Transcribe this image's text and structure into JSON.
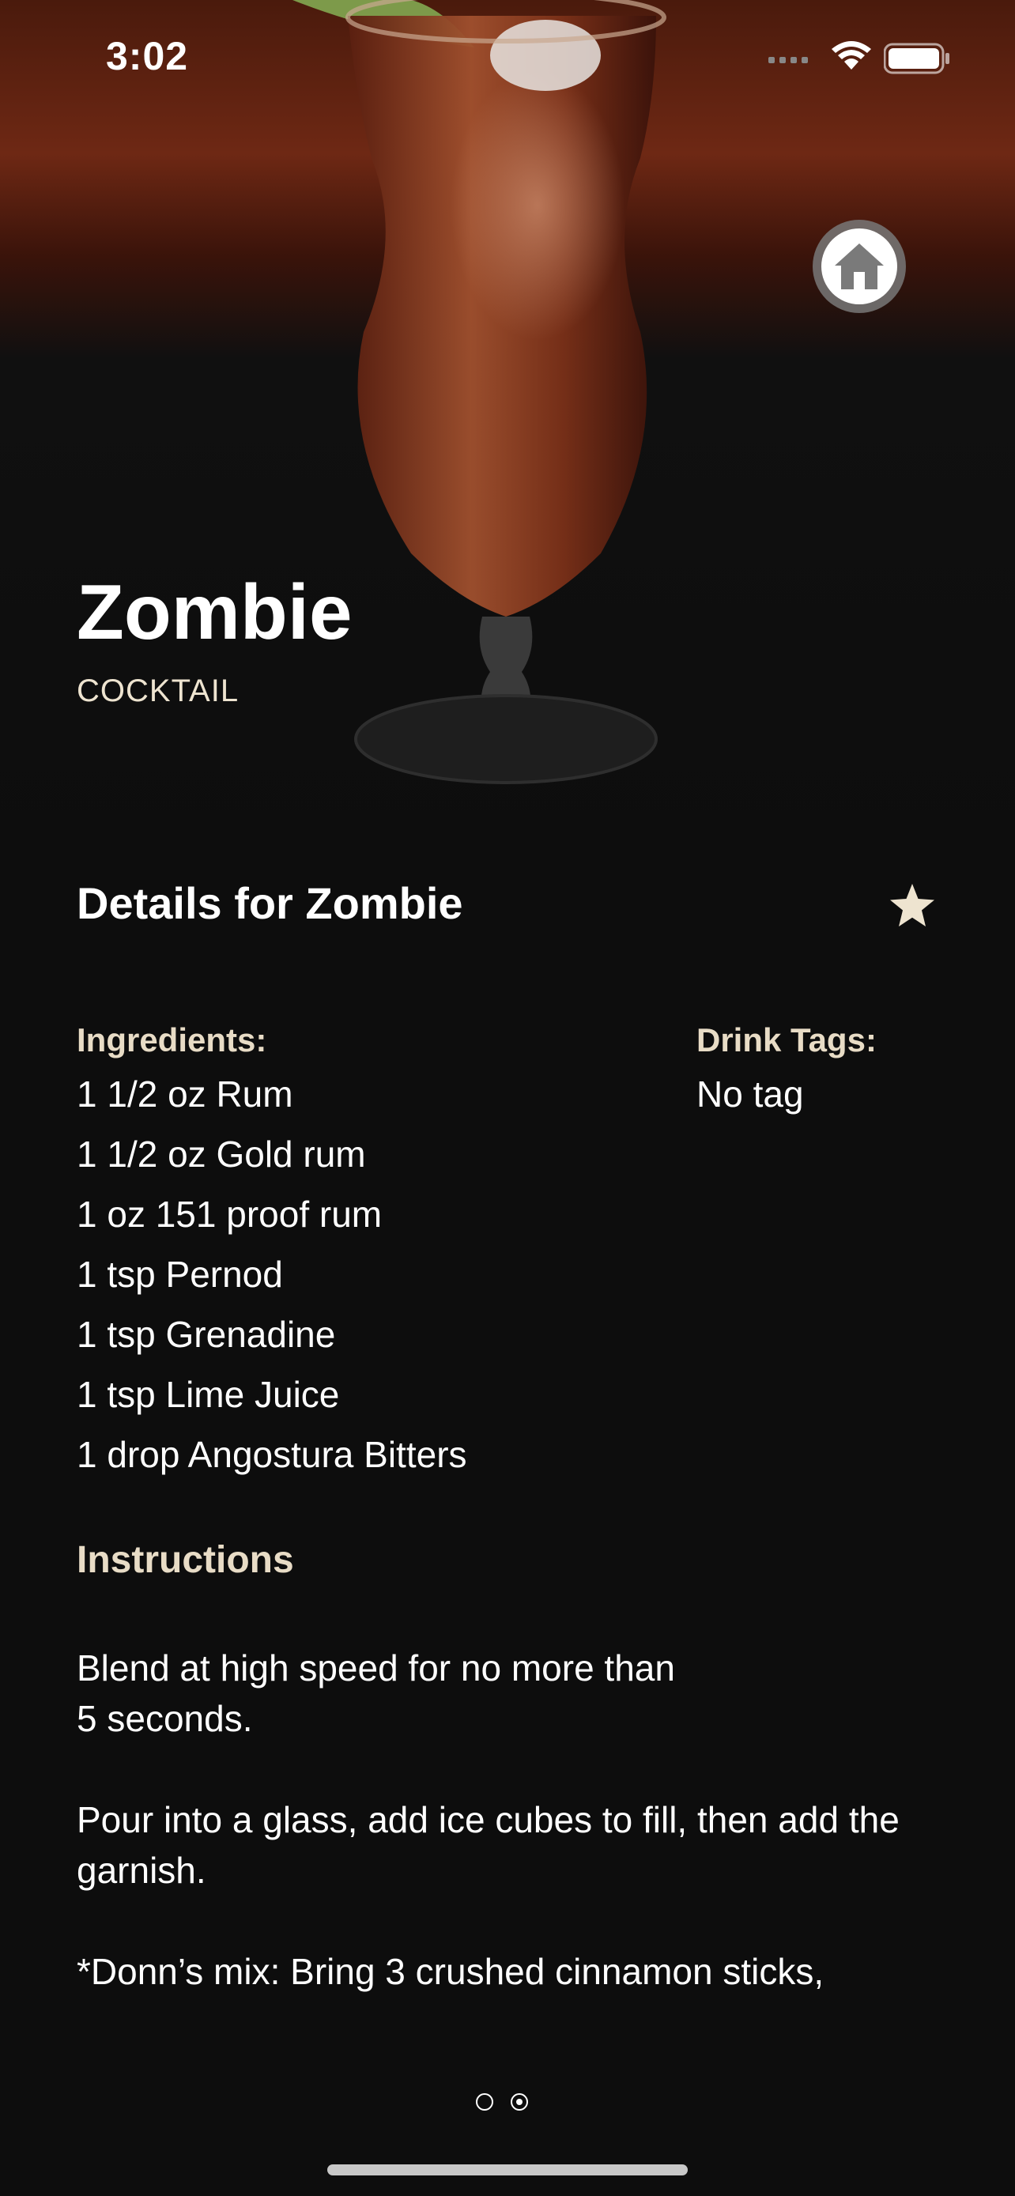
{
  "status_bar": {
    "time": "3:02"
  },
  "hero": {
    "image": "cocktail-glass-photo",
    "home_icon": "home-icon"
  },
  "drink": {
    "name": "Zombie",
    "category": "COCKTAIL"
  },
  "details": {
    "title": "Details for Zombie",
    "favorite_icon": "star-icon",
    "ingredients_label": "Ingredients:",
    "ingredients": [
      "1 1/2 oz Rum",
      "1 1/2 oz Gold rum",
      "1 oz 151 proof rum",
      "1 tsp Pernod",
      "1 tsp Grenadine",
      "1 tsp Lime Juice",
      "1 drop Angostura Bitters"
    ],
    "tags_label": "Drink Tags:",
    "tags_value": "No tag",
    "instructions_label": "Instructions",
    "instructions": "Blend at high speed for no more than\n5 seconds.\n\nPour into a glass, add ice cubes to fill, then add the garnish.\n\n*Donn’s mix: Bring 3 crushed cinnamon sticks,"
  },
  "pager": {
    "pages": 2,
    "current": 2
  },
  "colors": {
    "background": "#0d0d0d",
    "accent": "#e8dcc6"
  }
}
